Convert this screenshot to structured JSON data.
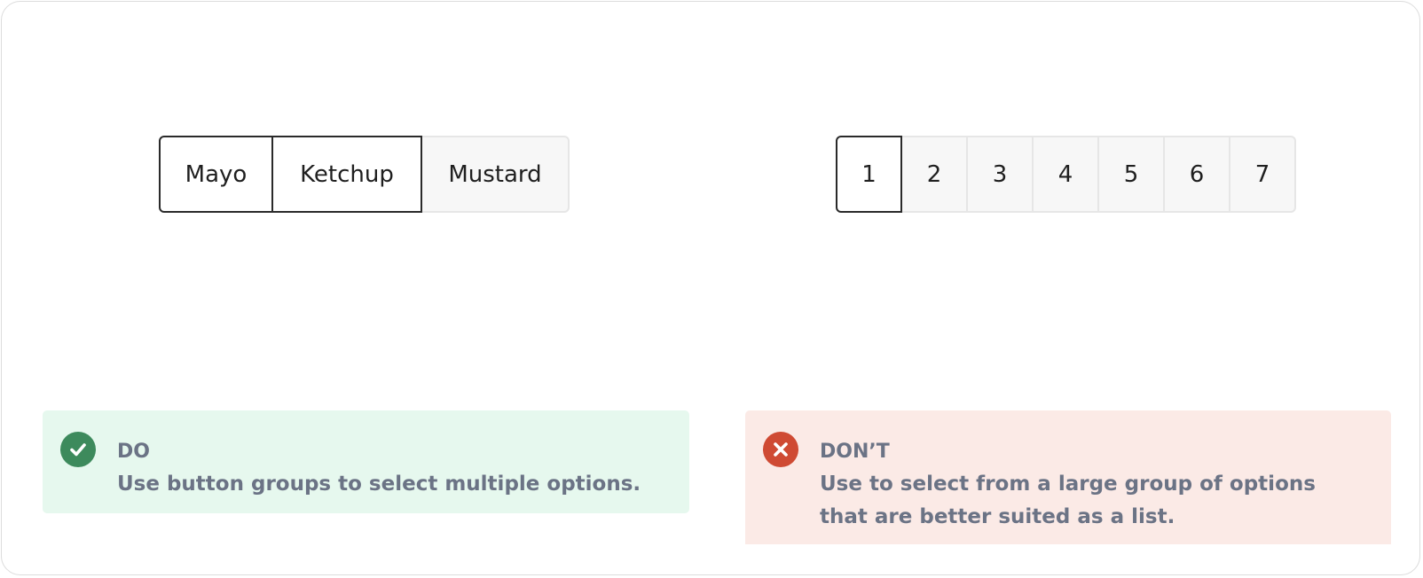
{
  "example_do": {
    "buttons": [
      {
        "label": "Mayo",
        "selected": true
      },
      {
        "label": "Ketchup",
        "selected": true
      },
      {
        "label": "Mustard",
        "selected": false
      }
    ]
  },
  "example_dont": {
    "buttons": [
      {
        "label": "1",
        "selected": true
      },
      {
        "label": "2",
        "selected": false
      },
      {
        "label": "3",
        "selected": false
      },
      {
        "label": "4",
        "selected": false
      },
      {
        "label": "5",
        "selected": false
      },
      {
        "label": "6",
        "selected": false
      },
      {
        "label": "7",
        "selected": false
      }
    ]
  },
  "guidelines": {
    "do": {
      "icon": "check-circle-icon",
      "title": "DO",
      "description": "Use button groups to select multiple options.",
      "accent": "#3d8a5c",
      "background": "#e6f8ee"
    },
    "dont": {
      "icon": "x-circle-icon",
      "title": "DON’T",
      "description": "Use to select from a large group of options that are better suited as a list.",
      "accent": "#cf4a33",
      "background": "#fbeae6"
    }
  }
}
